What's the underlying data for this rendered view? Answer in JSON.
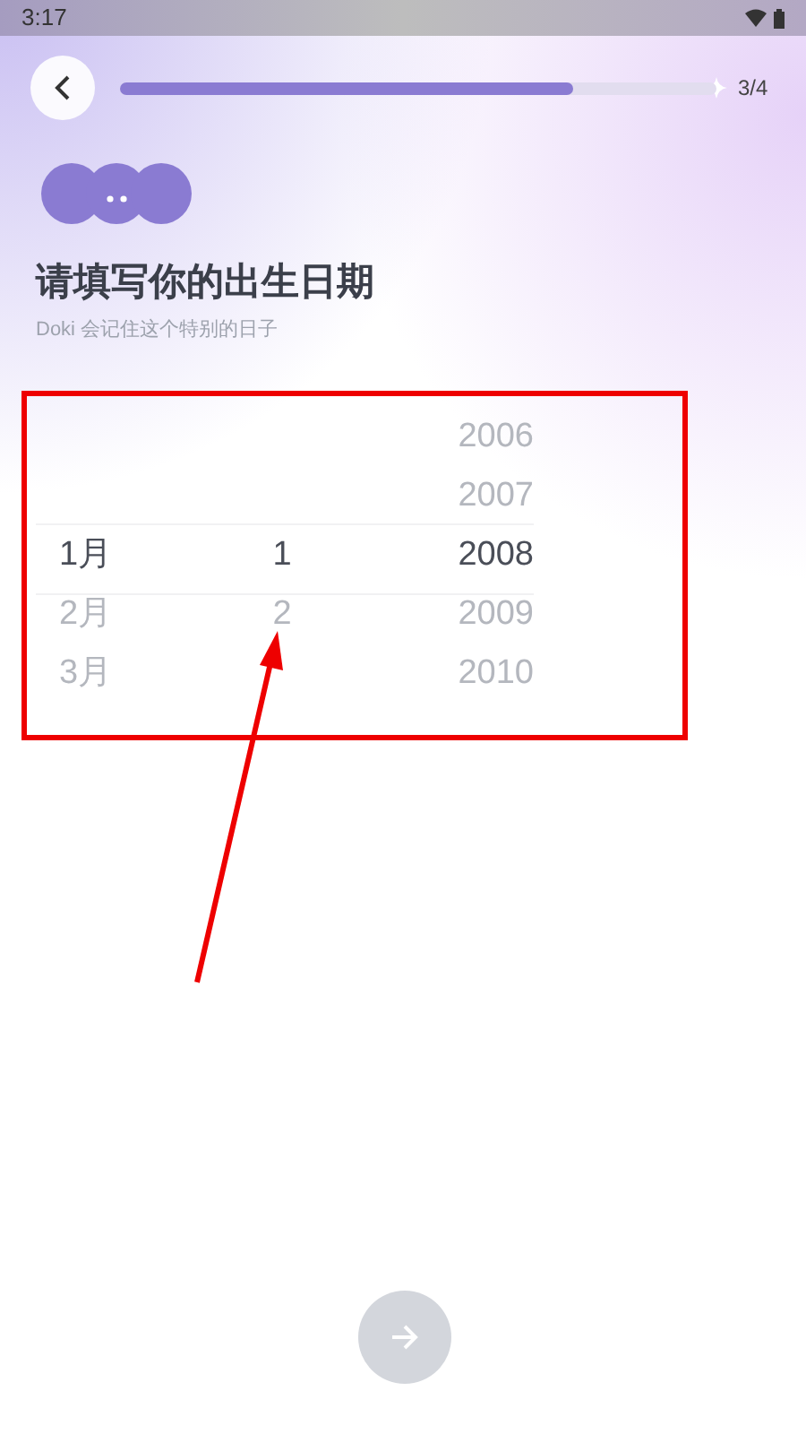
{
  "status_bar": {
    "time": "3:17"
  },
  "progress": {
    "level": 0.76,
    "step": "3/4"
  },
  "title": "请填写你的出生日期",
  "subtitle": "Doki 会记住这个特别的日子",
  "picker": {
    "columns": [
      {
        "items": [
          {
            "text": "1月",
            "selected": true
          },
          {
            "text": "2月",
            "selected": false
          },
          {
            "text": "3月",
            "selected": false
          }
        ]
      },
      {
        "items": [
          {
            "text": "1",
            "selected": true
          },
          {
            "text": "2",
            "selected": false
          }
        ]
      },
      {
        "items": [
          {
            "text": "2006",
            "selected": false
          },
          {
            "text": "2007",
            "selected": false
          },
          {
            "text": "2008",
            "selected": true
          },
          {
            "text": "2009",
            "selected": false
          },
          {
            "text": "2010",
            "selected": false
          }
        ]
      }
    ]
  },
  "next_button": {
    "disabled": true
  }
}
